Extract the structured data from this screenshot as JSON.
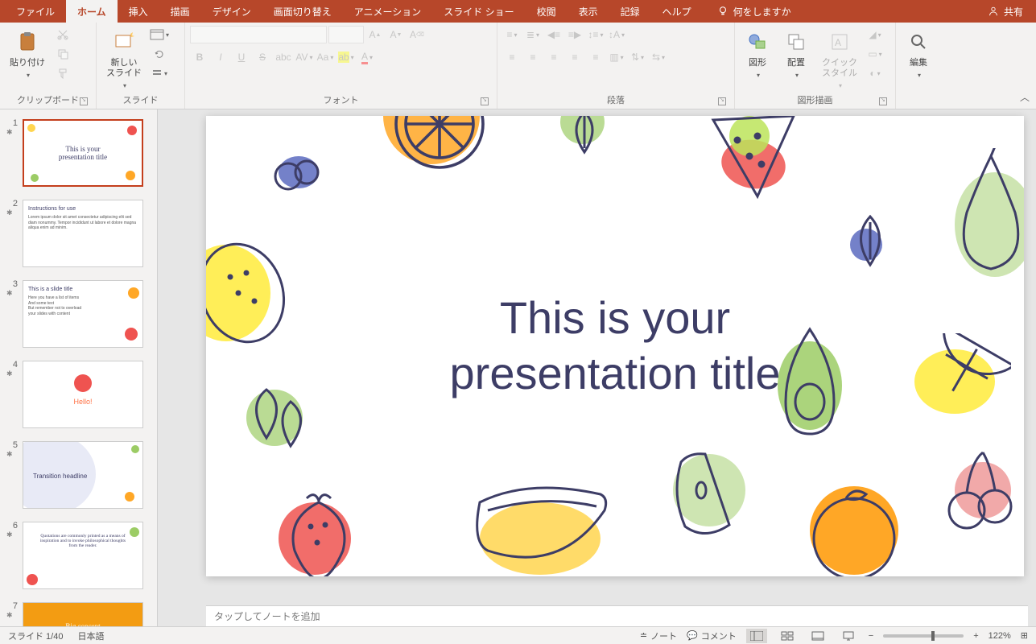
{
  "tabs": {
    "file": "ファイル",
    "home": "ホーム",
    "insert": "挿入",
    "draw": "描画",
    "design": "デザイン",
    "transitions": "画面切り替え",
    "animations": "アニメーション",
    "slideshow": "スライド ショー",
    "review": "校閲",
    "view": "表示",
    "recording": "記録",
    "help": "ヘルプ",
    "tellme": "何をしますか"
  },
  "share": "共有",
  "ribbon": {
    "clipboard": {
      "label": "クリップボード",
      "paste": "貼り付け"
    },
    "slides": {
      "label": "スライド",
      "newslide": "新しい\nスライド"
    },
    "font": {
      "label": "フォント"
    },
    "paragraph": {
      "label": "段落"
    },
    "drawing": {
      "label": "図形描画",
      "shapes": "図形",
      "arrange": "配置",
      "quickstyles": "クイック\nスタイル"
    },
    "editing": {
      "label": "編集"
    }
  },
  "slide": {
    "title_line1": "This is your",
    "title_line2": "presentation title"
  },
  "thumbnails": [
    {
      "num": "1",
      "title": "This is your\npresentation title"
    },
    {
      "num": "2",
      "heading": "Instructions for use"
    },
    {
      "num": "3",
      "heading": "This is a slide title"
    },
    {
      "num": "4",
      "heading": "Hello!"
    },
    {
      "num": "5",
      "heading": "Transition headline"
    },
    {
      "num": "6",
      "text": "Quotations are commonly printed as a means of inspiration and to invoke philosophical thoughts from the reader."
    },
    {
      "num": "7",
      "heading": "Big concept"
    }
  ],
  "notes_placeholder": "タップしてノートを追加",
  "status": {
    "slide_counter": "スライド 1/40",
    "language": "日本語",
    "notes": "ノート",
    "comments": "コメント",
    "zoom": "122%"
  }
}
